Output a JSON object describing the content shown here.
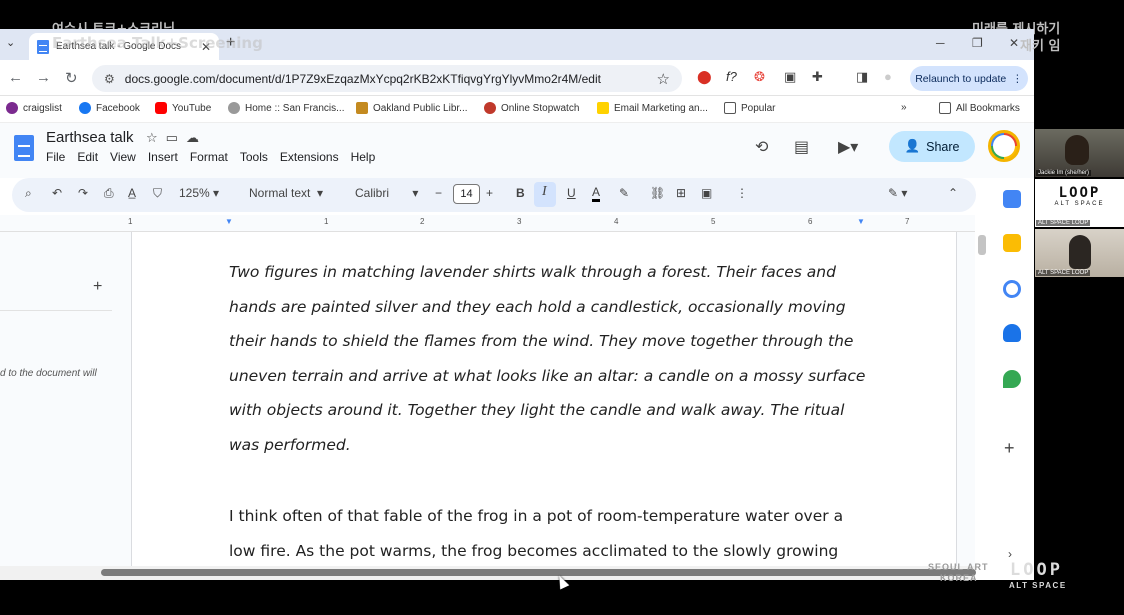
{
  "overlay": {
    "top_left_line1": "여수시 토크+스크리닝",
    "top_left_line2": "Earthsea Talk+Screening",
    "top_right_line1": "미래를 제시하기",
    "top_right_line2": "재키 임"
  },
  "browser": {
    "tab_title": "Earthsea talk - Google Docs",
    "url": "docs.google.com/document/d/1P7Z9xEzqazMxYcpq2rKB2xKTfiqvgYrgYlyvMmo2r4M/edit",
    "relaunch_label": "Relaunch to update",
    "bookmarks": [
      "craigslist",
      "Facebook",
      "YouTube",
      "Home :: San Francis...",
      "Oakland Public Libr...",
      "Online Stopwatch",
      "Email Marketing an...",
      "Popular"
    ],
    "all_bookmarks": "All Bookmarks"
  },
  "docs": {
    "title": "Earthsea talk",
    "menu": [
      "File",
      "Edit",
      "View",
      "Insert",
      "Format",
      "Tools",
      "Extensions",
      "Help"
    ],
    "share_label": "Share",
    "toolbar": {
      "zoom": "125%",
      "style": "Normal text",
      "font": "Calibri",
      "size": "14"
    },
    "ruler_numbers": [
      "1",
      "1",
      "2",
      "3",
      "4",
      "5",
      "6",
      "7"
    ],
    "left_panel_text": "d to the document will",
    "paragraph1": "Two figures in matching lavender shirts walk through a forest. Their faces and hands are painted silver and they each hold a candlestick, occasionally moving their hands to shield the flames from the wind. They move together through the uneven terrain and arrive at what looks like an altar: a candle on a mossy surface with objects around it. Together they light the candle and walk away. The ritual was performed.",
    "paragraph2": "I think often of that fable of the frog in a pot of room-temperature water over a low fire. As the pot warms, the frog becomes acclimated to the slowly growing"
  },
  "participants": [
    {
      "name": "Jackie Im (she/her)"
    },
    {
      "name": "ALT SPACE LOOP",
      "logo_big": "LOOP",
      "logo_small": "ALT SPACE"
    },
    {
      "name": "ALT SPACE LOOP"
    }
  ],
  "watermark": {
    "loop": "LOOP",
    "alt": "ALT SPACE",
    "seoul": "SEOUL ART",
    "korea": "KOREA"
  },
  "colors": {
    "accent": "#4285f4",
    "share_bg": "#c2e7ff",
    "tab_strip": "#dfe6f3"
  }
}
